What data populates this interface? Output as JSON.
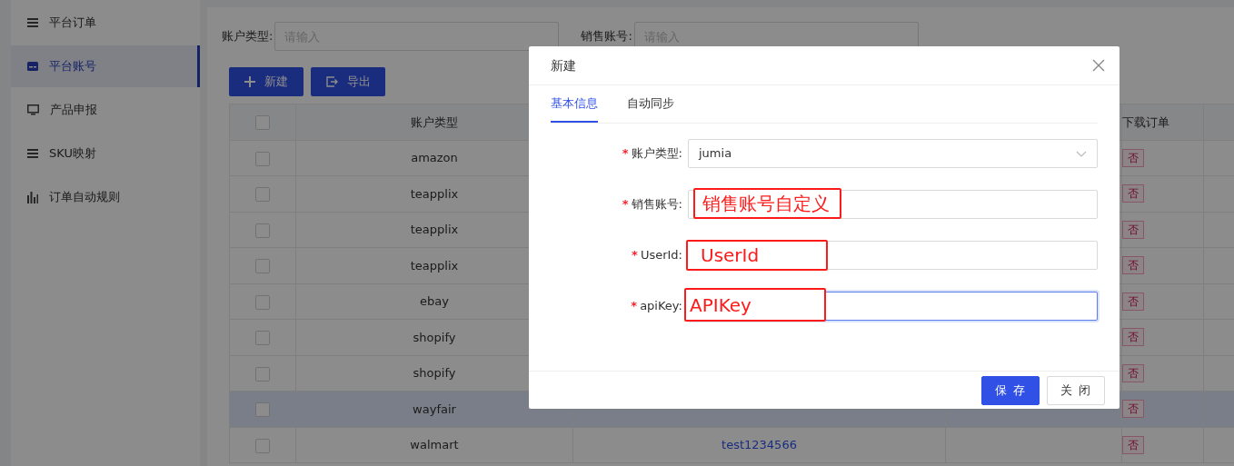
{
  "sidebar": {
    "items": [
      {
        "label": "平台订单",
        "selected": false
      },
      {
        "label": "平台账号",
        "selected": true
      },
      {
        "label": "产品申报",
        "selected": false
      },
      {
        "label": "SKU映射",
        "selected": false
      },
      {
        "label": "订单自动规则",
        "selected": false
      }
    ]
  },
  "filters": [
    {
      "label": "账户类型:",
      "placeholder": "请输入"
    },
    {
      "label": "销售账号:",
      "placeholder": "请输入"
    }
  ],
  "toolbar": {
    "buttons": [
      {
        "label": "新建"
      },
      {
        "label": "导出"
      }
    ]
  },
  "table": {
    "select_all_checked": false,
    "columns": {
      "account_type": "账户类型",
      "download_order": "下载订单"
    },
    "rows": [
      {
        "checked": false,
        "selected": false,
        "account_type": "amazon",
        "download_order": "否"
      },
      {
        "checked": false,
        "selected": false,
        "account_type": "teapplix",
        "download_order": "否"
      },
      {
        "checked": false,
        "selected": false,
        "account_type": "teapplix",
        "download_order": "否"
      },
      {
        "checked": false,
        "selected": false,
        "account_type": "teapplix",
        "download_order": "否"
      },
      {
        "checked": false,
        "selected": false,
        "account_type": "ebay",
        "download_order": "否"
      },
      {
        "checked": false,
        "selected": false,
        "account_type": "shopify",
        "download_order": "否"
      },
      {
        "checked": false,
        "selected": false,
        "account_type": "shopify",
        "download_order": "否"
      },
      {
        "checked": false,
        "selected": true,
        "account_type": "wayfair",
        "download_order": "否"
      },
      {
        "checked": false,
        "selected": false,
        "account_type": "walmart",
        "column_2": "test1234566",
        "download_order": "否"
      }
    ]
  },
  "modal": {
    "title": "新建",
    "tabs": [
      {
        "label": "基本信息",
        "selected": true
      },
      {
        "label": "自动同步",
        "selected": false
      }
    ],
    "fields": [
      {
        "kind": "select",
        "required_mark": "*",
        "label": "账户类型:",
        "value": "jumia",
        "focused": false
      },
      {
        "kind": "input",
        "required_mark": "*",
        "label": "销售账号:",
        "annotation": "销售账号自定义",
        "focused": false
      },
      {
        "kind": "input",
        "required_mark": "*",
        "label": "UserId:",
        "annotation": "UserId",
        "focused": false
      },
      {
        "kind": "input",
        "required_mark": "*",
        "label": "apiKey:",
        "annotation": "APIKey",
        "focused": true
      }
    ],
    "buttons": [
      {
        "label": "保 存",
        "primary": true
      },
      {
        "label": "关 闭",
        "primary": false
      }
    ]
  }
}
